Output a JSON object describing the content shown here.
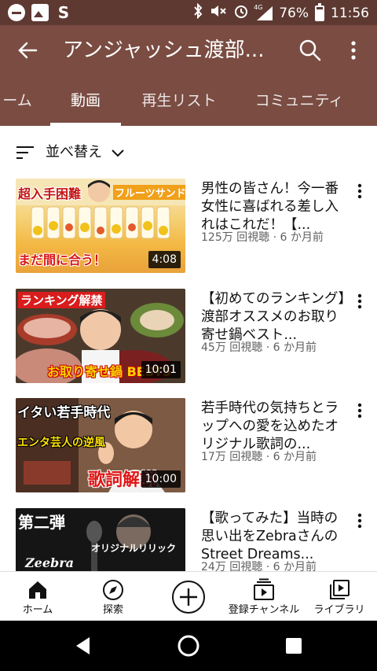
{
  "status_bar": {
    "battery": "76%",
    "time": "11:56",
    "network": "4G",
    "icons": [
      "dnd-icon",
      "photo-icon",
      "s-app-icon",
      "bluetooth-icon",
      "mute-icon",
      "alarm-icon",
      "signal-icon",
      "battery-icon"
    ]
  },
  "header": {
    "title": "アンジャッシュ渡部...",
    "tabs": [
      {
        "label": "ーム"
      },
      {
        "label": "動画"
      },
      {
        "label": "再生リスト"
      },
      {
        "label": "コミュニティ"
      }
    ]
  },
  "sort": {
    "label": "並べ替え"
  },
  "videos": [
    {
      "title": "男性の皆さん！今一番女性に喜ばれる差し入れはこれだ！【...",
      "meta": "125万 回視聴 · 6 か月前",
      "duration": "4:08",
      "thumb_text": [
        "超入手困難",
        "フルーツサンド",
        "まだ間に合う！"
      ]
    },
    {
      "title": "【初めてのランキング】渡部オススメのお取り寄せ鍋ベスト...",
      "meta": "45万 回視聴 · 6 か月前",
      "duration": "10:01",
      "thumb_text": [
        "ランキング解禁",
        "お取り寄せ鍋 BEST5"
      ]
    },
    {
      "title": "若手時代の気持ちとラップへの愛を込めたオリジナル歌詞の...",
      "meta": "17万 回視聴 · 6 か月前",
      "duration": "10:00",
      "thumb_text": [
        "イタい若手時代",
        "エンタ芸人の逆風",
        "歌詞解説"
      ]
    },
    {
      "title": "【歌ってみた】当時の思い出をZebraさんのStreet Dreams...",
      "meta": "24万 回視聴 · 6 か月前",
      "duration": "",
      "thumb_text": [
        "第二弾",
        "オリジナルリリック",
        "Zeebra"
      ]
    }
  ],
  "bottom_nav": [
    {
      "label": "ホーム",
      "icon": "home-icon"
    },
    {
      "label": "探索",
      "icon": "explore-icon"
    },
    {
      "label": "",
      "icon": "create-icon"
    },
    {
      "label": "登録チャンネル",
      "icon": "subscriptions-icon"
    },
    {
      "label": "ライブラリ",
      "icon": "library-icon"
    }
  ],
  "colors": {
    "status_bar": "#5d3931",
    "app_bar": "#7a4c42",
    "text_secondary": "#606060"
  }
}
